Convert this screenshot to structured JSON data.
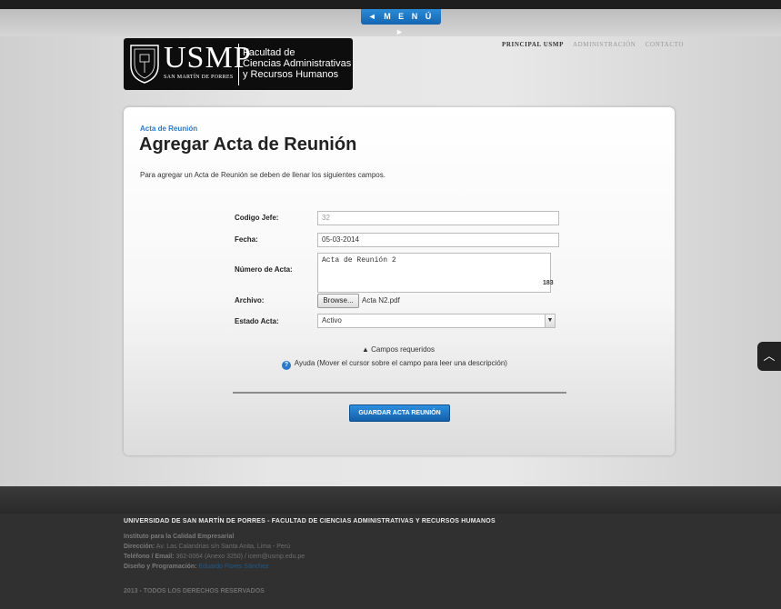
{
  "header": {
    "menu_label": "◄ M E N Ú ►",
    "logo": {
      "usmp": "USMP",
      "tagline": "SAN MARTÍN DE PORRES",
      "faculty_line1": "Facultad de",
      "faculty_line2": "Ciencias Administrativas",
      "faculty_line3": "y Recursos Humanos"
    },
    "nav": [
      "PRINCIPAL USMP",
      "ADMINISTRACIÓN",
      "CONTACTO"
    ]
  },
  "form": {
    "breadcrumb": "Acta de Reunión",
    "title": "Agregar Acta de Reunión",
    "intro": "Para agregar un Acta de Reunión se deben de llenar los siguientes campos.",
    "fields": {
      "codigo_label": "Codigo Jefe:",
      "codigo_value": "32",
      "fecha_label": "Fecha:",
      "fecha_value": "05-03-2014",
      "numero_label": "Número de Acta:",
      "numero_value": "Acta de Reunión 2",
      "numero_counter": "183",
      "archivo_label": "Archivo:",
      "browse_label": "Browse...",
      "file_name": "Acta N2.pdf",
      "estado_label": "Estado Acta:",
      "estado_value": "Activo"
    },
    "required_note": "Campos requeridos",
    "help_note": "Ayuda (Mover el cursor sobre el campo para leer una descripción)",
    "save_label": "GUARDAR ACTA REUNIÓN"
  },
  "scroll_top_icon": "chevron-up-icon",
  "footer": {
    "title": "UNIVERSIDAD DE SAN MARTÍN DE PORRES - FACULTAD DE CIENCIAS ADMINISTRATIVAS Y RECURSOS HUMANOS",
    "institute": "Instituto para la Calidad Empresarial",
    "address_label": "Dirección:",
    "address_value": "Av. Las Calandrias s/n Santa Anita, Lima - Perú",
    "phone_label": "Teléfono / Email:",
    "phone_value": "362-0064 (Anexo 3250) / icem@usmp.edu.pe",
    "design_label": "Diseño y Programación:",
    "design_value": "Eduardo Flores Sánchez",
    "copyright": "2013 - TODOS LOS DERECHOS RESERVADOS"
  },
  "colors": {
    "accent": "#1a73c4",
    "footer_bg": "#303030"
  }
}
